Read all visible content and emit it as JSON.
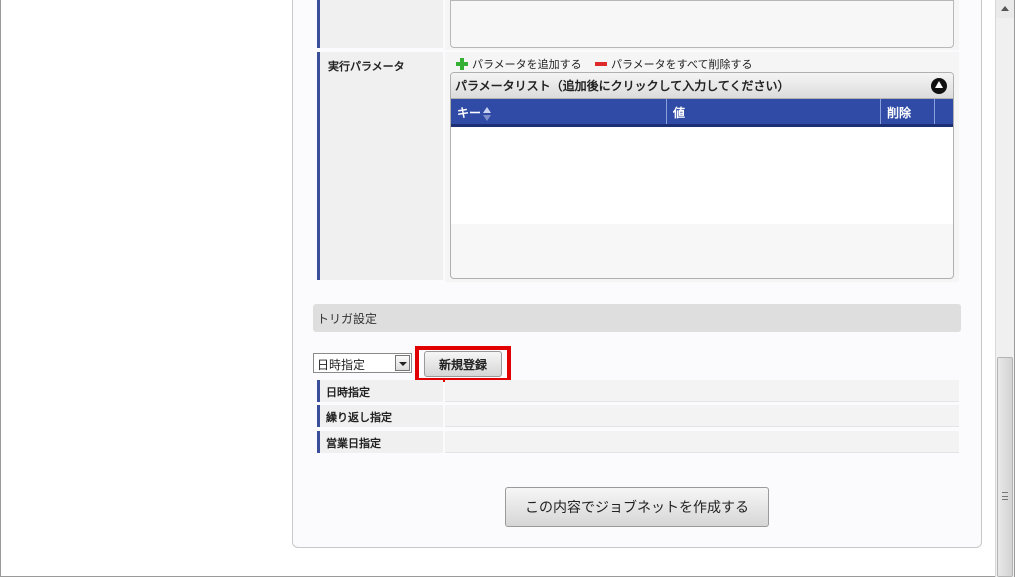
{
  "params": {
    "row_label": "実行パラメータ",
    "add_label": "パラメータを追加する",
    "remove_all_label": "パラメータをすべて削除する",
    "grid_caption": "パラメータリスト（追加後にクリックして入力してください）",
    "columns": [
      "キー",
      "値",
      "削除"
    ]
  },
  "trigger": {
    "section_title": "トリガ設定",
    "select_value": "日時指定",
    "new_button": "新規登録",
    "rows": [
      "日時指定",
      "繰り返し指定",
      "営業日指定"
    ]
  },
  "footer": {
    "create_button": "この内容でジョブネットを作成する"
  },
  "colors": {
    "accent": "#2f4ba6",
    "highlight": "#e00000",
    "add": "#35b035",
    "remove": "#dd2a2a"
  }
}
